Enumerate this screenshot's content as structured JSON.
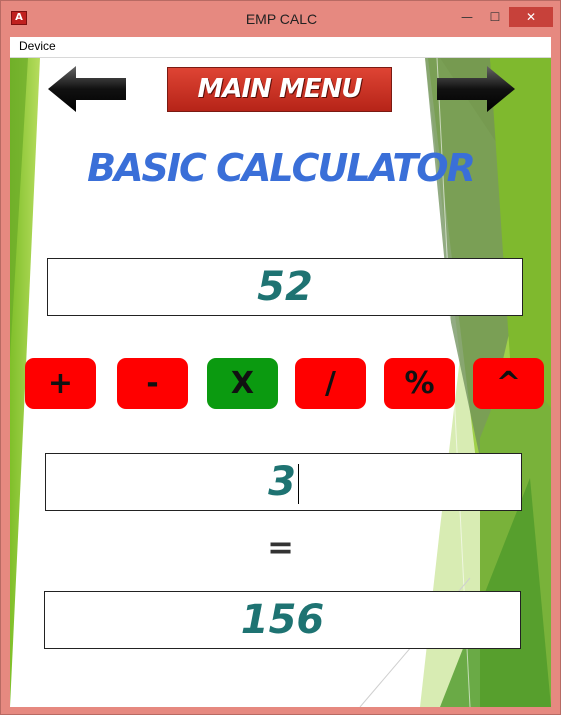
{
  "window": {
    "title": "EMP CALC",
    "app_icon_glyph": "A",
    "controls": {
      "minimize": "—",
      "maximize": "☐",
      "close": "✕"
    }
  },
  "menubar": {
    "device_label": "Device"
  },
  "header": {
    "main_menu_label": "MAIN MENU",
    "title": "BASIC CALCULATOR"
  },
  "calculator": {
    "operand_a": "52",
    "operand_b": "3",
    "operators": [
      "+",
      "-",
      "X",
      "/",
      "%",
      "^"
    ],
    "selected_operator": "X",
    "equals_label": "=",
    "result": "156"
  },
  "colors": {
    "operator_button": "#ff0000",
    "operator_selected": "#0b9a10",
    "display_text": "#1e7372",
    "title_text": "#3a6fd8",
    "main_menu_button": "#c8301f",
    "window_frame": "#e68980"
  },
  "icons": {
    "back": "arrow-left-icon",
    "forward": "arrow-right-icon"
  }
}
